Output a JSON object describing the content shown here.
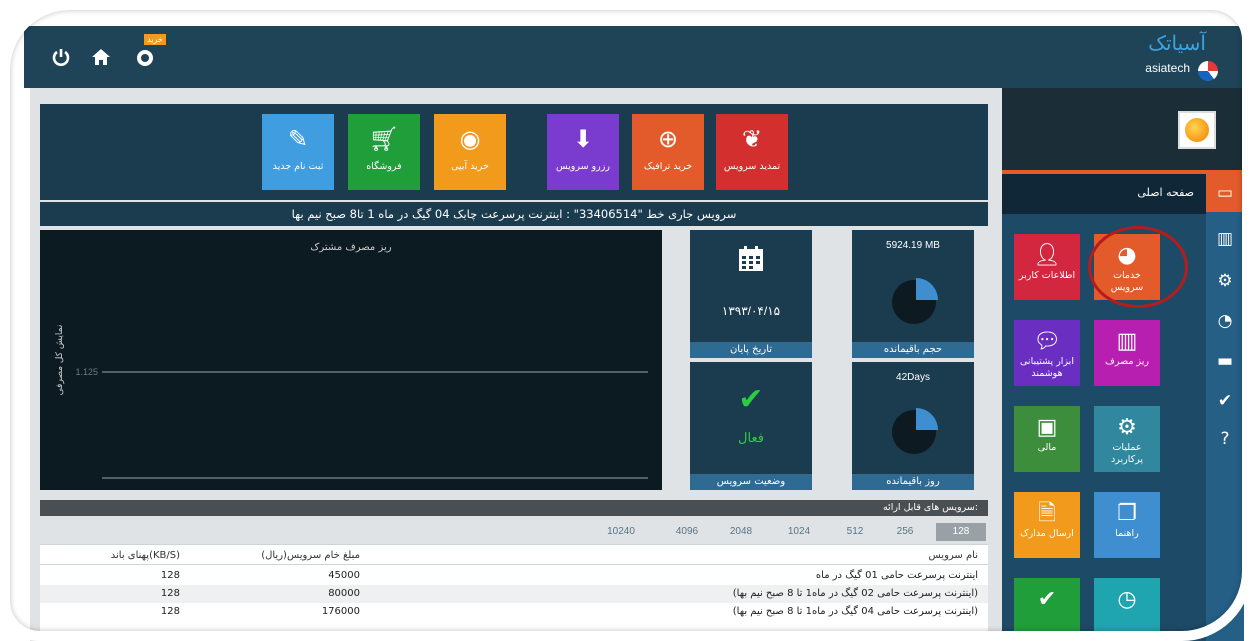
{
  "topbar": {
    "logo_fa": "آسیاتک",
    "logo_en": "asiatech",
    "notification_badge": "خرید",
    "icons": [
      "power-icon",
      "home-icon",
      "notification-icon"
    ]
  },
  "sidebar": {
    "main_menu_label": "صفحه اصلی",
    "tiles": [
      {
        "label": "خدمات سرویس",
        "icon": "speedometer-icon",
        "color": "#e35a2b"
      },
      {
        "label": "اطلاعات کاربر",
        "icon": "user-icon",
        "color": "#d3263f"
      },
      {
        "label": "ریز مصرف",
        "icon": "bar-chart-icon",
        "color": "#b71fb0"
      },
      {
        "label": "ابزار پشتیبانی هوشمند",
        "icon": "chat-icon",
        "color": "#6a2fc0"
      },
      {
        "label": "عملیات پرکاربرد",
        "icon": "gears-icon",
        "color": "#31879e"
      },
      {
        "label": "مالی",
        "icon": "money-icon",
        "color": "#3c8d3c"
      },
      {
        "label": "راهنما",
        "icon": "copy-icon",
        "color": "#3f8fd0"
      },
      {
        "label": "ارسال مدارک",
        "icon": "document-icon",
        "color": "#f29a1b"
      },
      {
        "label": "",
        "icon": "check-icon",
        "color": "#1f9e3a"
      },
      {
        "label": "",
        "icon": "clock-icon",
        "color": "#1fa5b0"
      }
    ],
    "rail_icons": [
      "monitor-icon",
      "bar-chart-icon",
      "gears-icon",
      "speedometer-icon",
      "card-icon",
      "check-icon",
      "help-icon"
    ]
  },
  "actions": [
    {
      "label": "تمدید سرویس",
      "icon": "leaf-icon",
      "color": "#d32f2f"
    },
    {
      "label": "خرید ترافیک",
      "icon": "plus-circle-icon",
      "color": "#e35a2b"
    },
    {
      "label": "رزرو سرویس",
      "icon": "download-icon",
      "color": "#7a3ccf"
    },
    {
      "label": "خرید آیپی",
      "icon": "globe-icon",
      "color": "#f29a1b"
    },
    {
      "label": "فروشگاه",
      "icon": "cart-icon",
      "color": "#1f9e3a"
    },
    {
      "label": "ثبت نام جدید",
      "icon": "pencil-icon",
      "color": "#3f9de0"
    }
  ],
  "current_service": "سرویس جاری خط \"33406514\" : اینترنت پرسرعت چابک 04 گیگ در ماه 1 تا8 صبح نیم بها",
  "chart_data": {
    "type": "line",
    "title": "ریز مصرف مشترک",
    "ylabel": "نمایش کل مصرفی",
    "yticks": [
      "1.125"
    ],
    "series": []
  },
  "stats": {
    "remaining_volume": {
      "value": "5924.19 MB",
      "label": "حجم باقیمانده"
    },
    "end_date": {
      "value": "۱۳۹۳/۰۴/۱۵",
      "label": "تاریخ پایان"
    },
    "remaining_days": {
      "value": "42Days",
      "label": "روز باقیمانده"
    },
    "service_status": {
      "value": "فعال",
      "label": "وضعیت سرویس"
    }
  },
  "services_header": "سرویس های قابل ارائه:",
  "bandwidth_tabs": [
    "128",
    "256",
    "512",
    "1024",
    "2048",
    "4096",
    "10240"
  ],
  "active_bandwidth": "128",
  "table": {
    "headers": {
      "name": "نام سرویس",
      "price": "مبلغ خام سرویس(ریال)",
      "speed": "پهنای باند(KB/S)"
    },
    "rows": [
      {
        "name": "اینترنت پرسرعت حامی 01 گیگ در ماه",
        "price": "45000",
        "speed": "128"
      },
      {
        "name": "(اینترنت پرسرعت حامی 02 گیگ در ماه1 تا 8 صبح نیم بها)",
        "price": "80000",
        "speed": "128"
      },
      {
        "name": "(اینترنت پرسرعت حامی 04 گیگ در ماه1 تا 8 صبح نیم بها)",
        "price": "176000",
        "speed": "128"
      }
    ]
  }
}
